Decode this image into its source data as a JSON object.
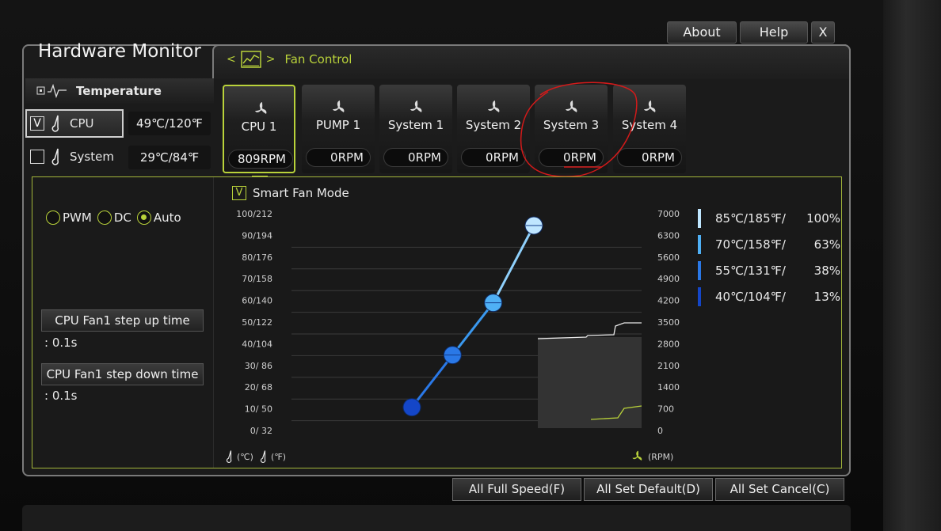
{
  "window": {
    "title": "Hardware Monitor"
  },
  "top_buttons": {
    "about": "About",
    "help": "Help",
    "close": "X"
  },
  "section_tab": {
    "label": "Fan Control",
    "nav_prev": "<",
    "nav_next": ">"
  },
  "temperature": {
    "header": "Temperature",
    "sensors": [
      {
        "name": "CPU",
        "value": "49℃/120℉",
        "checked": "V"
      },
      {
        "name": "System",
        "value": "29℃/84℉",
        "checked": ""
      }
    ]
  },
  "fans": [
    {
      "name": "CPU 1",
      "rpm": "809RPM"
    },
    {
      "name": "PUMP 1",
      "rpm": "0RPM"
    },
    {
      "name": "System 1",
      "rpm": "0RPM"
    },
    {
      "name": "System 2",
      "rpm": "0RPM"
    },
    {
      "name": "System 3",
      "rpm": "0RPM"
    },
    {
      "name": "System 4",
      "rpm": "0RPM"
    }
  ],
  "mode": {
    "pwm": "PWM",
    "dc": "DC",
    "auto": "Auto",
    "selected": "Auto"
  },
  "step_up": {
    "label": "CPU Fan1 step up time",
    "value": ": 0.1s"
  },
  "step_down": {
    "label": "CPU Fan1 step down time",
    "value": ": 0.1s"
  },
  "smart_fan": {
    "checked": "V",
    "label": "Smart Fan Mode"
  },
  "chart_units": {
    "left": "(℃)",
    "left2": "(℉)",
    "right": "(RPM)"
  },
  "legend": [
    {
      "temp": "85℃/185℉/",
      "pct": "100%",
      "color": "#bfe6ff"
    },
    {
      "temp": "70℃/158℉/",
      "pct": "63%",
      "color": "#4fb0f5"
    },
    {
      "temp": "55℃/131℉/",
      "pct": "38%",
      "color": "#2a78e6"
    },
    {
      "temp": "40℃/104℉/",
      "pct": "13%",
      "color": "#1446c8"
    }
  ],
  "bottom_buttons": {
    "full_speed": "All Full Speed(F)",
    "set_default": "All Set Default(D)",
    "set_cancel": "All Set Cancel(C)"
  },
  "colors": {
    "accent": "#b9d23a",
    "panel": "#1b1b1b"
  },
  "chart_data": {
    "type": "line",
    "y_left_ticks": [
      "100/212",
      "90/194",
      "80/176",
      "70/158",
      "60/140",
      "50/122",
      "40/104",
      "30/ 86",
      "20/ 68",
      "10/ 50",
      "0/ 32"
    ],
    "y_right_ticks": [
      "7000",
      "6300",
      "5600",
      "4900",
      "4200",
      "3500",
      "2800",
      "2100",
      "1400",
      "700",
      "0"
    ],
    "ylim": [
      0,
      100
    ],
    "series": [
      {
        "points": [
          {
            "temp": 40,
            "pct": 13
          },
          {
            "temp": 55,
            "pct": 38
          },
          {
            "temp": 70,
            "pct": 63
          },
          {
            "temp": 85,
            "pct": 100
          }
        ]
      }
    ],
    "grid": true
  }
}
